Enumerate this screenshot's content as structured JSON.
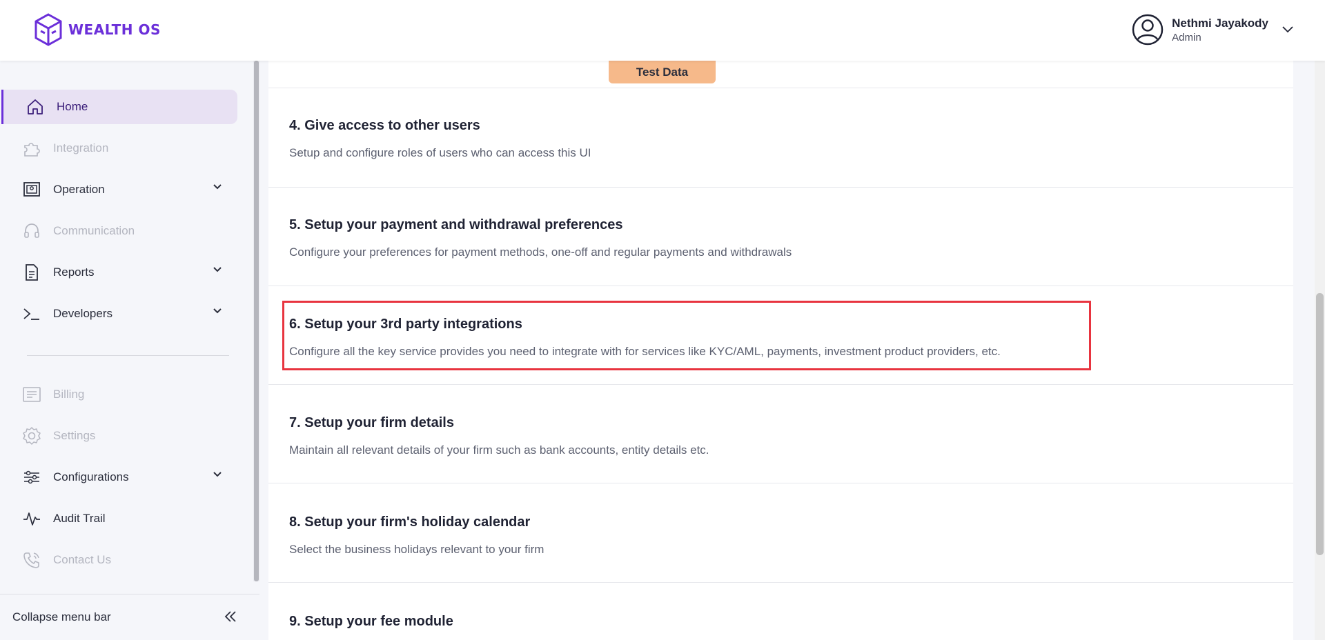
{
  "header": {
    "logo_text": "WEALTH OS",
    "user_name": "Nethmi Jayakody",
    "user_role": "Admin"
  },
  "sidebar": {
    "items": [
      {
        "label": "Home",
        "icon": "home-icon",
        "state": "active"
      },
      {
        "label": "Integration",
        "icon": "puzzle-icon",
        "state": "disabled"
      },
      {
        "label": "Operation",
        "icon": "operation-icon",
        "state": "normal",
        "expandable": true
      },
      {
        "label": "Communication",
        "icon": "headset-icon",
        "state": "disabled"
      },
      {
        "label": "Reports",
        "icon": "document-icon",
        "state": "normal",
        "expandable": true
      },
      {
        "label": "Developers",
        "icon": "terminal-icon",
        "state": "normal",
        "expandable": true
      },
      {
        "label": "Billing",
        "icon": "receipt-icon",
        "state": "disabled"
      },
      {
        "label": "Settings",
        "icon": "gear-icon",
        "state": "disabled"
      },
      {
        "label": "Configurations",
        "icon": "sliders-icon",
        "state": "normal",
        "expandable": true
      },
      {
        "label": "Audit Trail",
        "icon": "activity-icon",
        "state": "normal"
      },
      {
        "label": "Contact Us",
        "icon": "phone-icon",
        "state": "disabled"
      }
    ],
    "collapse_label": "Collapse menu bar"
  },
  "main": {
    "test_data_label": "Test Data",
    "steps": [
      {
        "title": "4. Give access to other users",
        "desc": "Setup and configure roles of users who can access this UI"
      },
      {
        "title": "5. Setup your payment and withdrawal preferences",
        "desc": "Configure your preferences for payment methods, one-off and regular payments and withdrawals"
      },
      {
        "title": "6. Setup your 3rd party integrations",
        "desc": "Configure all the key service provides you need to integrate with for services like KYC/AML, payments, investment product providers, etc."
      },
      {
        "title": "7. Setup your firm details",
        "desc": "Maintain all relevant details of your firm such as bank accounts, entity details etc."
      },
      {
        "title": "8. Setup your firm's holiday calendar",
        "desc": "Select the business holidays relevant to your firm"
      },
      {
        "title": "9. Setup your fee module",
        "desc": ""
      }
    ]
  },
  "colors": {
    "brand": "#6b2fd9",
    "active_bg": "#e8e1f3",
    "test_data_bg": "#f6b98a",
    "highlight": "#e8343f"
  }
}
